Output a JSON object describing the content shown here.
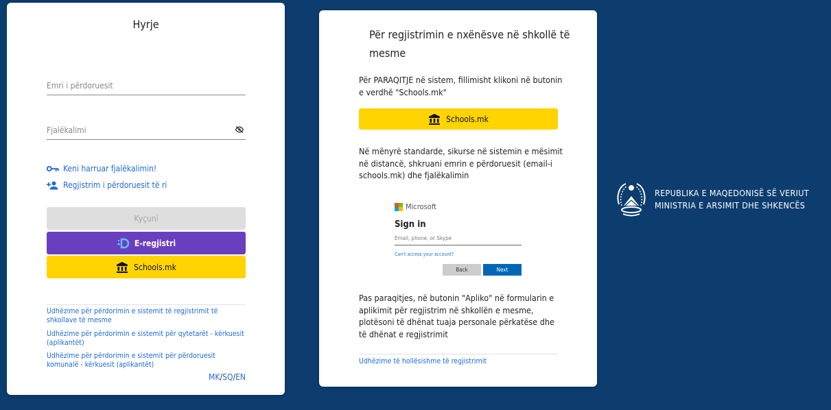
{
  "login": {
    "title": "Hyrje",
    "username_placeholder": "Emri i përdoruesit",
    "password_placeholder": "Fjalëkalimi",
    "forgot_password": "Keni harruar fjalëkalimin!",
    "register_user": "Regjistrim i përdoruesit të ri",
    "login_button": "Kyçuni",
    "eregjistri_button": "E-regjistri",
    "schools_button": "Schools.mk",
    "guides": [
      "Udhëzime për përdorimin e sistemit të regjistrimit të shkollave të mesme",
      "Udhëzime për përdorimin e sistemit për qytetarët - kërkuesit (aplikantët)",
      "Udhëzime për përdorimin e sistemit për përdoruesit komunalë - kërkuesit (aplikantët)"
    ],
    "languages": [
      "MK",
      "SQ",
      "EN"
    ]
  },
  "info": {
    "title": "Për regjistrimin e nxënësve në shkollë të mesme",
    "para1": "Për PARAQITJE në sistem, fillimisht klikoni në butonin e verdhë \"Schools.mk\"",
    "schools_button": "Schools.mk",
    "para2": "Në mënyrë standarde, sikurse në sistemin e mësimit në distancë, shkruani emrin e përdoruesit (email-i schools.mk) dhe fjalëkalimin",
    "ms_brand": "Microsoft",
    "ms_signin": "Sign in",
    "ms_input_placeholder": "Email, phone, or Skype",
    "ms_cant_access": "Can't access your account?",
    "ms_back": "Back",
    "ms_next": "Next",
    "para3": "Pas paraqitjes, në butonin \"Apliko\" në formularin e aplikimit për regjistrim në shkollën e mesme, plotësoni të dhënat tuaja personale përkatëse dhe të dhënat e regjistrimit",
    "details_link": "Udhëzime të hollësishme të regjistrimit"
  },
  "ministry": {
    "line1": "REPUBLIKA E MAQEDONISË SË VERIUT",
    "line2": "MINISTRIA E ARSIMIT DHE SHKENCËS"
  },
  "colors": {
    "background": "#0d3d6e",
    "link": "#1e6bd6",
    "purple": "#6a3fbf",
    "yellow": "#ffd400",
    "disabled": "#dedede"
  }
}
